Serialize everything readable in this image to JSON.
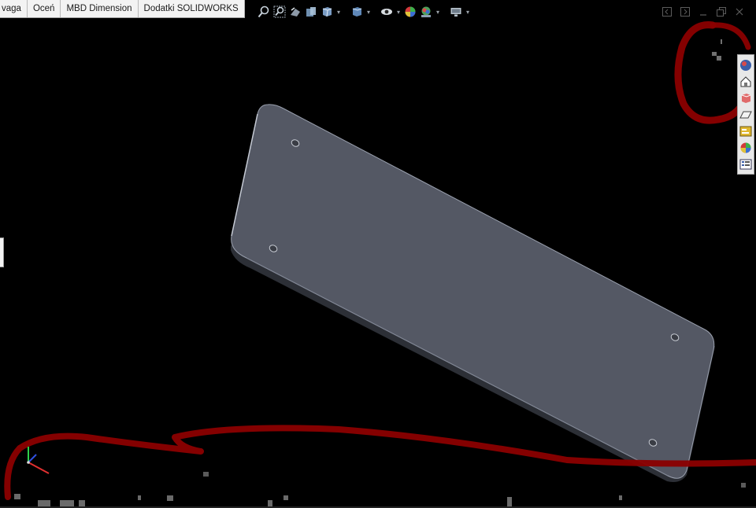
{
  "ribbon": {
    "tabs": [
      "vaga",
      "Oceń",
      "MBD Dimension",
      "Dodatki SOLIDWORKS"
    ]
  },
  "view_toolbar": {
    "icons": [
      "zoom-to-fit-icon",
      "zoom-to-area-icon",
      "previous-view-icon",
      "section-view-icon",
      "view-orientation-icon",
      "display-style-icon",
      "hide-show-items-icon",
      "edit-appearance-icon",
      "apply-scene-icon",
      "view-settings-icon"
    ]
  },
  "window_controls": {
    "icons": [
      "tile-left-icon",
      "tile-right-icon",
      "minimize-icon",
      "restore-icon",
      "close-icon"
    ]
  },
  "task_pane": {
    "icons": [
      "solidworks-resources-icon",
      "design-library-icon",
      "file-explorer-icon",
      "view-palette-icon",
      "custom-properties-icon",
      "appearances-scenes-icon",
      "forum-icon"
    ]
  },
  "colors": {
    "background": "#000000",
    "part_face": "#545864",
    "part_edge": "#9aa0ae",
    "annotation_red": "#8b0000"
  }
}
